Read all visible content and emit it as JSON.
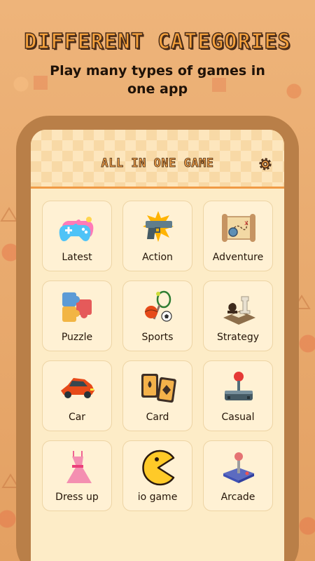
{
  "hero": {
    "title": "DIFFERENT CATEGORIES",
    "subtitle": "Play many types of games in one app"
  },
  "app": {
    "title": "ALL IN ONE GAME",
    "settings_icon": "gear-icon"
  },
  "categories": [
    {
      "label": "Latest",
      "icon": "gamepad-icon"
    },
    {
      "label": "Action",
      "icon": "pistol-icon"
    },
    {
      "label": "Adventure",
      "icon": "treasure-map-icon"
    },
    {
      "label": "Puzzle",
      "icon": "puzzle-piece-icon"
    },
    {
      "label": "Sports",
      "icon": "sports-balls-icon"
    },
    {
      "label": "Strategy",
      "icon": "chess-pieces-icon"
    },
    {
      "label": "Car",
      "icon": "car-icon"
    },
    {
      "label": "Card",
      "icon": "playing-cards-icon"
    },
    {
      "label": "Casual",
      "icon": "joystick-icon"
    },
    {
      "label": "Dress up",
      "icon": "dress-icon"
    },
    {
      "label": "io game",
      "icon": "pacman-icon"
    },
    {
      "label": "Arcade",
      "icon": "arcade-stick-icon"
    }
  ],
  "colors": {
    "background": "#e8a867",
    "accent": "#f4a24a",
    "panel": "#fdecc7",
    "tile": "#fff1d4",
    "frame": "#b97f48"
  }
}
